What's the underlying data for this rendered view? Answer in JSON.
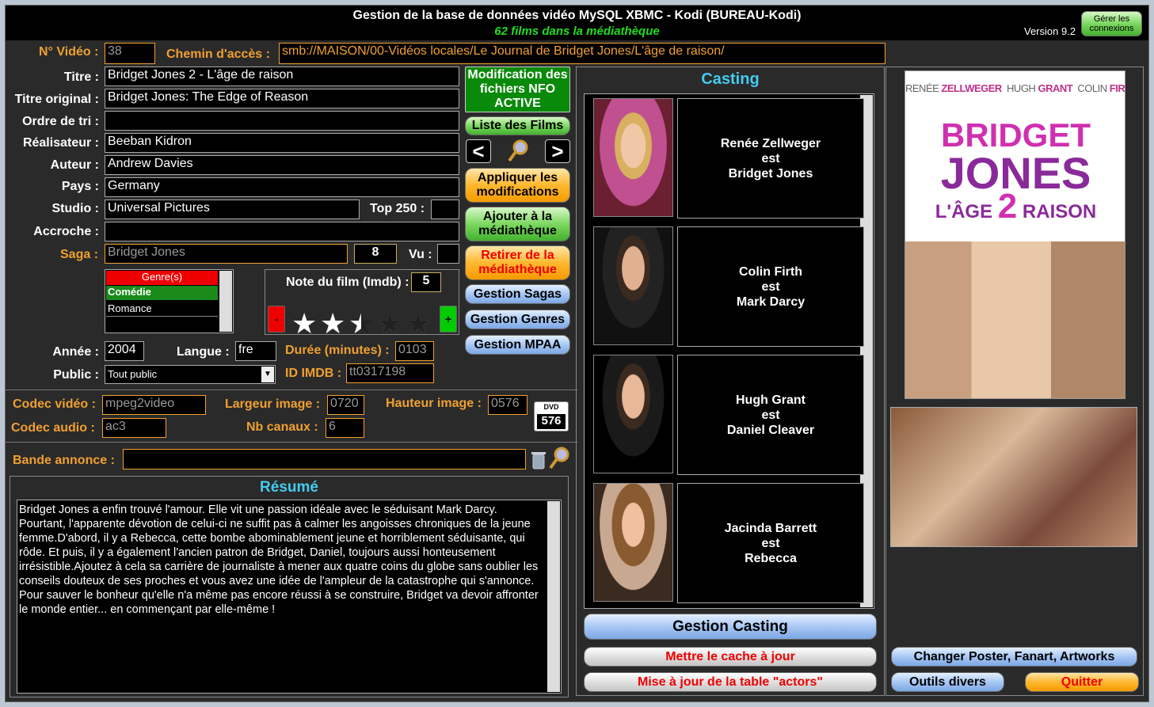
{
  "header": {
    "title": "Gestion de la base de données vidéo MySQL XBMC - Kodi (BUREAU-Kodi)",
    "subtitle": "62 films dans la médiathèque",
    "version": "Version 9.2",
    "connections_button": "Gérer les connexions"
  },
  "fields": {
    "num_video_label": "N° Vidéo :",
    "num_video": "38",
    "path_label": "Chemin d'accès :",
    "path": "smb://MAISON/00-Vidéos locales/Le Journal de Bridget Jones/L'âge de raison/",
    "title_label": "Titre :",
    "title": "Bridget Jones 2 - L'âge de raison",
    "orig_title_label": "Titre original :",
    "orig_title": "Bridget Jones: The Edge of Reason",
    "sort_label": "Ordre de tri :",
    "sort": "",
    "director_label": "Réalisateur :",
    "director": "Beeban Kidron",
    "author_label": "Auteur :",
    "author": "Andrew Davies",
    "country_label": "Pays :",
    "country": "Germany",
    "studio_label": "Studio :",
    "studio": "Universal Pictures",
    "top250_label": "Top 250 :",
    "top250": "",
    "tagline_label": "Accroche :",
    "tagline": "",
    "saga_label": "Saga :",
    "saga": "Bridget Jones",
    "saga_num": "8",
    "seen_label": "Vu :",
    "seen": "",
    "rating_label": "Note du film (Imdb) :",
    "rating": "5",
    "rating_stars": 2.5,
    "minus": "-",
    "plus": "+",
    "year_label": "Année :",
    "year": "2004",
    "lang_label": "Langue :",
    "lang": "fre",
    "duration_label": "Durée (minutes) :",
    "duration": "0103",
    "public_label": "Public :",
    "public": "Tout public",
    "imdb_label": "ID IMDB :",
    "imdb": "tt0317198",
    "vcodec_label": "Codec vidéo :",
    "vcodec": "mpeg2video",
    "width_label": "Largeur image :",
    "width": "0720",
    "height_label": "Hauteur image :",
    "height": "0576",
    "acodec_label": "Codec audio :",
    "acodec": "ac3",
    "channels_label": "Nb canaux :",
    "channels": "6",
    "dvd_badge_top": "DVD",
    "dvd_badge_num": "576",
    "trailer_label": "Bande annonce :",
    "trailer": ""
  },
  "genres": {
    "header": "Genre(s)",
    "items": [
      "Comédie",
      "Romance"
    ]
  },
  "buttons": {
    "nfo": "Modification des fichiers NFO ACTIVE",
    "film_list": "Liste des Films",
    "prev": "<",
    "next": ">",
    "apply": "Appliquer les modifications",
    "add": "Ajouter à la médiathèque",
    "remove": "Retirer de la médiathèque",
    "sagas": "Gestion Sagas",
    "genres": "Gestion Genres",
    "mpaa": "Gestion MPAA",
    "casting": "Gestion Casting",
    "cache": "Mettre le cache à jour",
    "actors": "Mise à jour de la table \"actors\"",
    "artwork": "Changer Poster, Fanart, Artworks",
    "tools": "Outils divers",
    "quit": "Quitter"
  },
  "summary": {
    "title": "Résumé",
    "text": "Bridget Jones a enfin trouvé l'amour. Elle vit une passion idéale avec le séduisant Mark Darcy. Pourtant, l'apparente dévotion de celui-ci ne suffit pas à calmer les angoisses chroniques de la jeune femme.D'abord, il y a Rebecca, cette bombe abominablement jeune et horriblement séduisante, qui rôde. Et puis, il y a également l'ancien patron de Bridget, Daniel, toujours aussi honteusement irrésistible.Ajoutez à cela sa carrière de journaliste à mener aux quatre coins du globe sans oublier les conseils douteux de ses proches et vous avez une idée de l'ampleur de la catastrophe qui s'annonce. Pour sauver le bonheur qu'elle n'a même pas encore réussi à se construire, Bridget va devoir affronter le monde entier... en commençant par elle-même !"
  },
  "casting": {
    "title": "Casting",
    "actors": [
      {
        "name": "Renée Zellweger",
        "as": "est",
        "role": "Bridget Jones"
      },
      {
        "name": "Colin Firth",
        "as": "est",
        "role": "Mark Darcy"
      },
      {
        "name": "Hugh Grant",
        "as": "est",
        "role": "Daniel Cleaver"
      },
      {
        "name": "Jacinda Barrett",
        "as": "est",
        "role": "Rebecca"
      }
    ]
  },
  "poster": {
    "names": [
      "RENÉE",
      "ZELLWEGER",
      "HUGH",
      "GRANT",
      "COLIN",
      "FIRTH"
    ],
    "line1": "BRIDGET",
    "line2": "JONES",
    "line3a": "L'ÂGE",
    "line3b": "2",
    "line3c": "RAISON"
  },
  "colors": {
    "accent_green": "#22dd22",
    "casting_title": "#44ccee",
    "label_orange": "#f0a030"
  }
}
